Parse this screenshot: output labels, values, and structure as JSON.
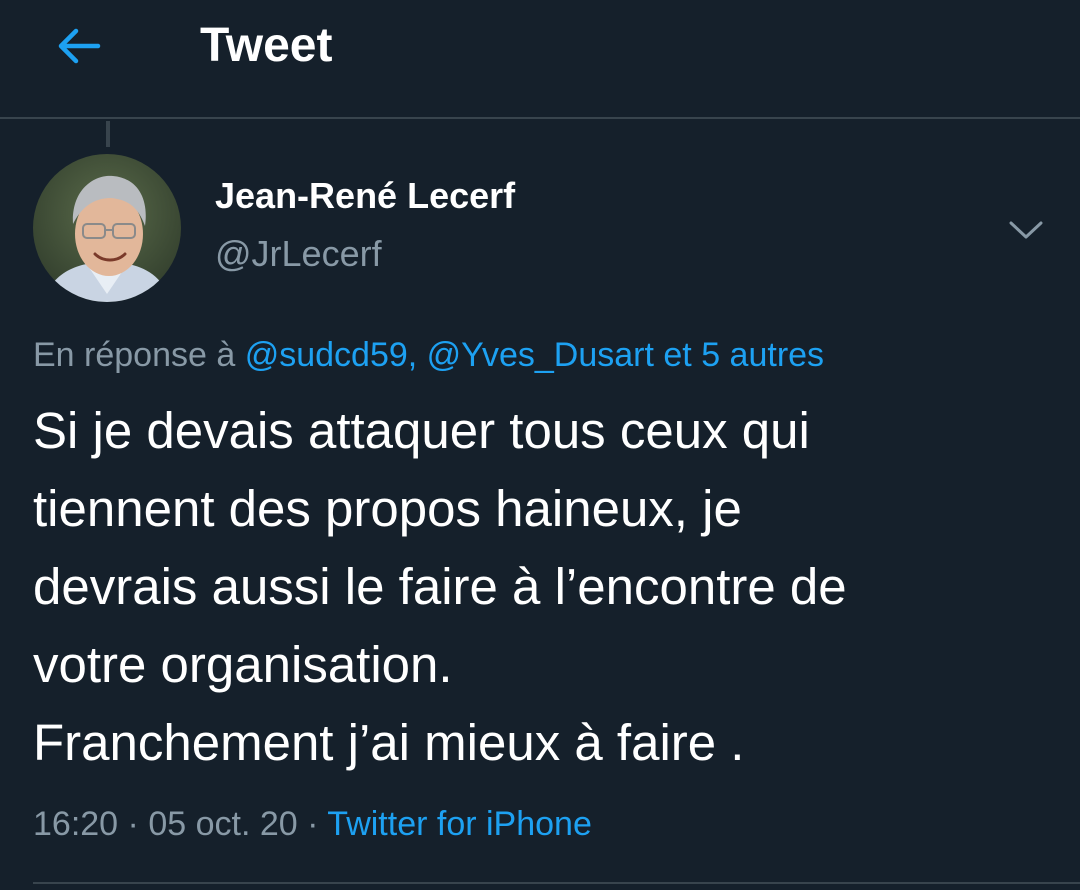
{
  "header": {
    "title": "Tweet",
    "back_icon": "arrow-left-icon"
  },
  "tweet": {
    "author": {
      "name": "Jean-René Lecerf",
      "handle": "@JrLecerf"
    },
    "more_icon": "chevron-down-icon",
    "reply_context": {
      "prefix": "En réponse à",
      "mentions": "@sudcd59, @Yves_Dusart et 5 autres"
    },
    "text_lines": [
      "Si je devais attaquer tous ceux qui",
      "tiennent des propos haineux, je",
      "devrais aussi le faire à l’encontre de",
      "votre organisation.",
      "Franchement j’ai mieux à faire ."
    ],
    "time": "16:20",
    "date": "05 oct. 20",
    "separator": "·",
    "source": "Twitter for iPhone"
  },
  "colors": {
    "background": "#15202b",
    "accent": "#1da1f2",
    "secondary_text": "#8899a6",
    "divider": "#38444d"
  }
}
